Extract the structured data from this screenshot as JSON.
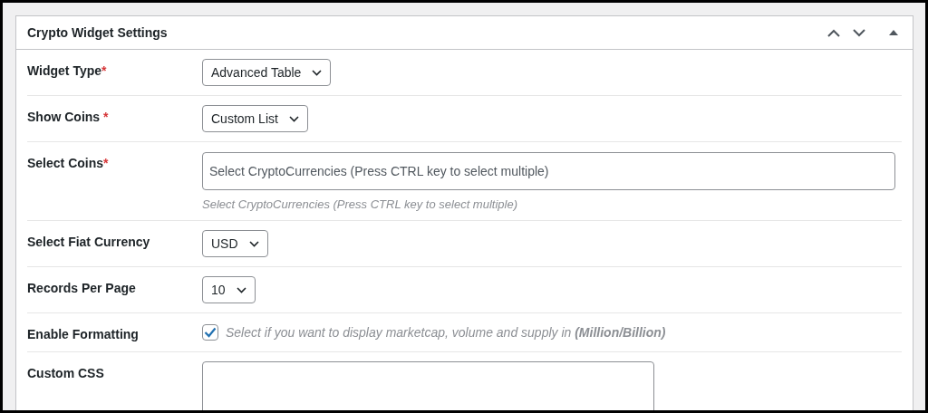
{
  "panel": {
    "title": "Crypto Widget Settings"
  },
  "fields": [
    {
      "kind": "select",
      "label": "Widget Type",
      "required_mark": "*",
      "value": "Advanced Table"
    },
    {
      "kind": "select",
      "label": "Show Coins",
      "required_mark": " *",
      "value": "Custom List"
    },
    {
      "kind": "multiselect",
      "label": "Select Coins",
      "required_mark": "*",
      "placeholder": "Select CryptoCurrencies (Press CTRL key to select multiple)",
      "description": "Select CryptoCurrencies (Press CTRL key to select multiple)"
    },
    {
      "kind": "select",
      "label": "Select Fiat Currency",
      "value": "USD"
    },
    {
      "kind": "select",
      "label": "Records Per Page",
      "value": "10"
    },
    {
      "kind": "checkbox",
      "label": "Enable Formatting",
      "checked": true,
      "description": "Select if you want to display marketcap, volume and supply in **(Million/Billion)**"
    },
    {
      "kind": "textarea",
      "label": "Custom CSS"
    }
  ]
}
